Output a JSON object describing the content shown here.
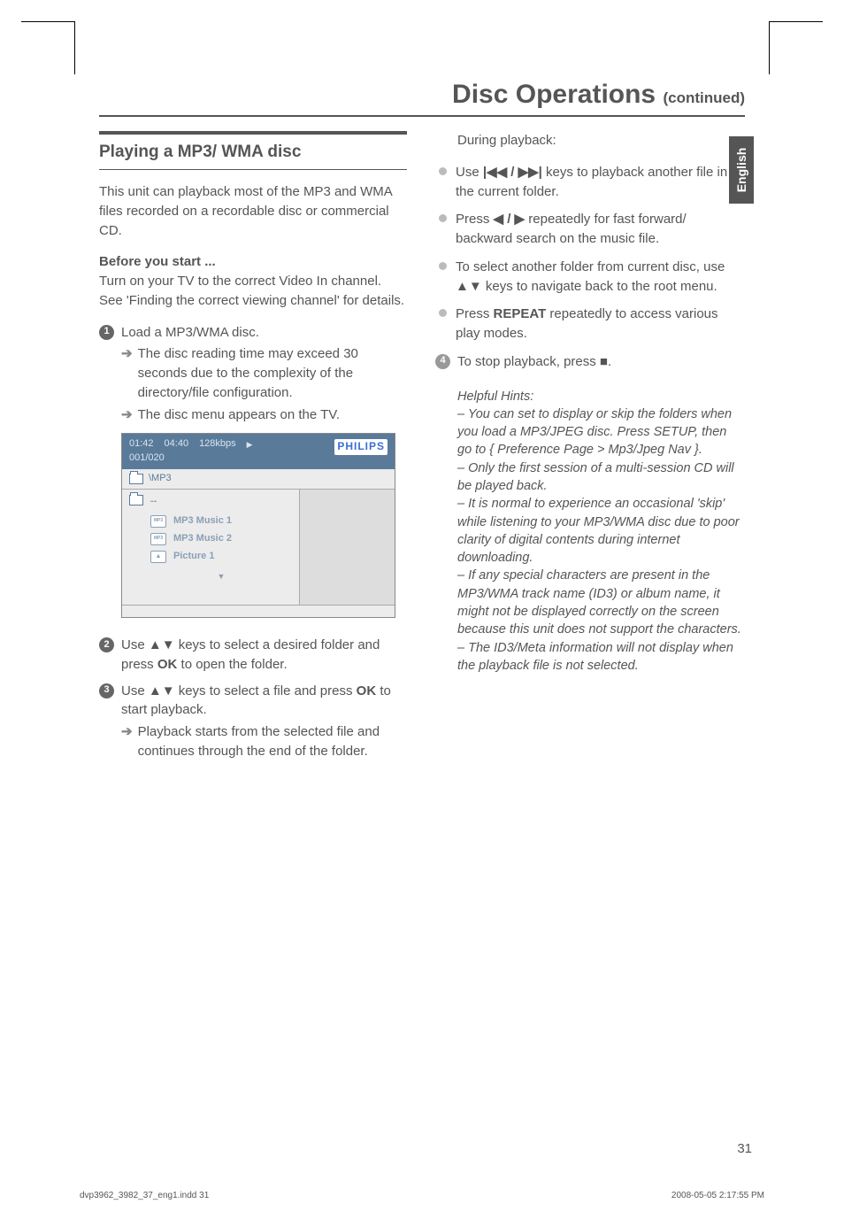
{
  "header": {
    "title_bold": "Disc Operations ",
    "title_cont": "(continued)"
  },
  "sidetab": "English",
  "left": {
    "section_title": "Playing a MP3/ WMA disc",
    "intro": "This unit can playback most of the MP3 and WMA files recorded on a recordable disc or commercial CD.",
    "before_label": "Before you start ...",
    "before_text": "Turn on your TV to the correct Video In channel. See 'Finding the correct viewing channel' for details.",
    "step1": "Load a MP3/WMA disc.",
    "step1_a": "The disc reading time may exceed 30 seconds due to the complexity of the directory/file configuration.",
    "step1_b": "The disc menu appears on the TV.",
    "step2_a": "Use ",
    "step2_b": " keys to select a desired folder and press ",
    "step2_ok": "OK",
    "step2_c": " to open the folder.",
    "step3_a": "Use ",
    "step3_b": " keys to select a file and press ",
    "step3_ok": "OK",
    "step3_c": " to start playback.",
    "step3_arrow": "Playback starts from the selected file and continues through the end of the folder."
  },
  "shot": {
    "time1": "01:42",
    "time2": "04:40",
    "kbps": "128kbps",
    "counter": "001/020",
    "brand": "PHILIPS",
    "tab": "\\MP3",
    "f1": "MP3 Music 1",
    "f2": "MP3 Music 2",
    "f3": "Picture 1"
  },
  "right": {
    "during": "During playback:",
    "b1a": "Use ",
    "b1b": " keys to playback another file in the current folder.",
    "b2a": "Press ",
    "b2b": " repeatedly for fast forward/ backward search on the music file.",
    "b3a": "To select another folder from current disc, use ",
    "b3b": " keys to navigate back to the root menu.",
    "b4a": "Press ",
    "b4repeat": "REPEAT",
    "b4b": " repeatedly to access various play modes.",
    "step4a": "To stop playback, press ",
    "step4b": ".",
    "hints_title": "Helpful Hints:",
    "h1": "– You can set to display or skip the folders when you load a MP3/JPEG disc. Press SETUP, then go to { Preference Page > Mp3/Jpeg Nav }.",
    "h2": "– Only the first session of a multi-session CD will be played back.",
    "h3": "– It is normal to experience an occasional 'skip' while listening to your MP3/WMA disc due to poor clarity of digital contents during internet downloading.",
    "h4": "– If any special characters are present in the MP3/WMA track name (ID3) or album name, it might not be displayed correctly on the screen because this unit does not support the characters.",
    "h5": "– The ID3/Meta information will not display when the playback file is not selected."
  },
  "footer": {
    "pagenum": "31",
    "left": "dvp3962_3982_37_eng1.indd   31",
    "right": "2008-05-05   2:17:55 PM"
  }
}
